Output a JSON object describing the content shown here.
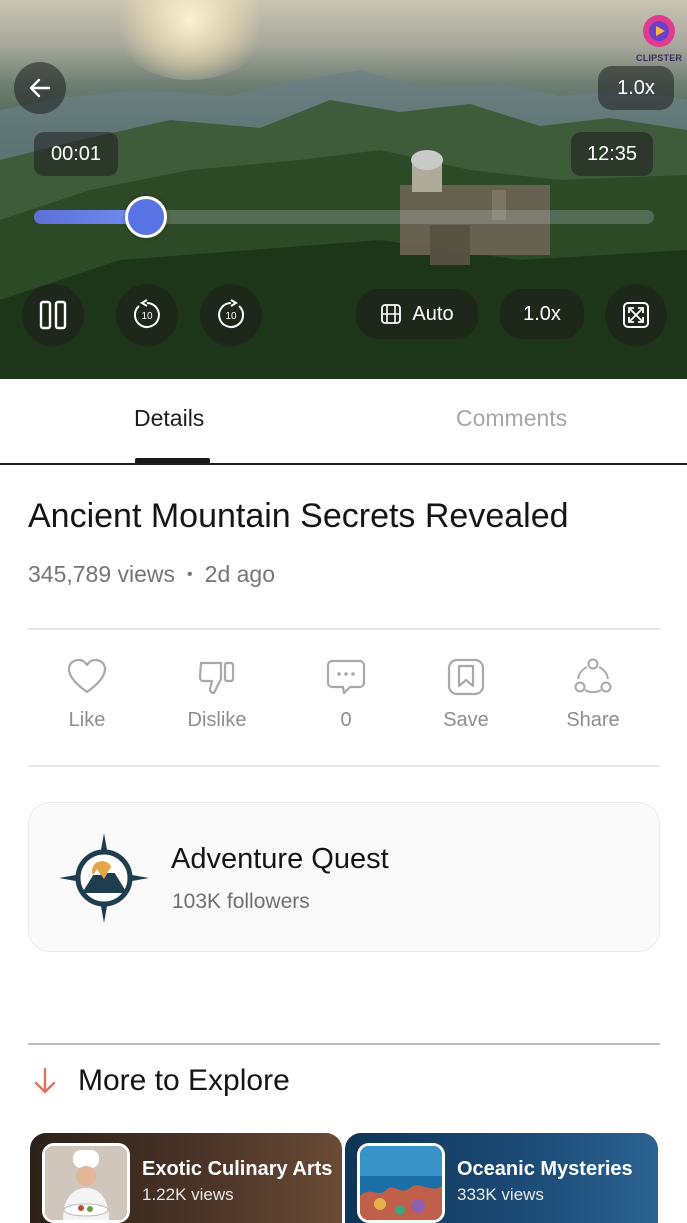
{
  "player": {
    "brand_name": "CLIPSTER",
    "playback_speed_badge": "1.0x",
    "current_time": "00:01",
    "total_time": "12:35",
    "progress": 0.18,
    "quality_label": "Auto",
    "speed_label": "1.0x",
    "rewind_seconds": "10",
    "forward_seconds": "10"
  },
  "tabs": [
    {
      "label": "Details",
      "active": true
    },
    {
      "label": "Comments",
      "active": false
    }
  ],
  "video": {
    "title": "Ancient Mountain Secrets Revealed",
    "views": "345,789 views",
    "separator": "•",
    "age": "2d ago"
  },
  "actions": [
    {
      "label": "Like",
      "icon": "heart-icon"
    },
    {
      "label": "Dislike",
      "icon": "thumbs-down-icon"
    },
    {
      "label": "0",
      "icon": "comment-bubble-icon"
    },
    {
      "label": "Save",
      "icon": "bookmark-icon"
    },
    {
      "label": "Share",
      "icon": "share-icon"
    }
  ],
  "channel": {
    "name": "Adventure Quest",
    "followers": "103K followers",
    "logo_icon": "compass-mountain-logo"
  },
  "more": {
    "title": "More to Explore",
    "cards": [
      {
        "title": "Exotic Culinary Arts",
        "views": "1.22K views"
      },
      {
        "title": "Oceanic Mysteries",
        "views": "333K views"
      }
    ]
  },
  "colors": {
    "accent": "#5874e4",
    "text_primary": "#151515",
    "text_secondary": "#757575"
  }
}
